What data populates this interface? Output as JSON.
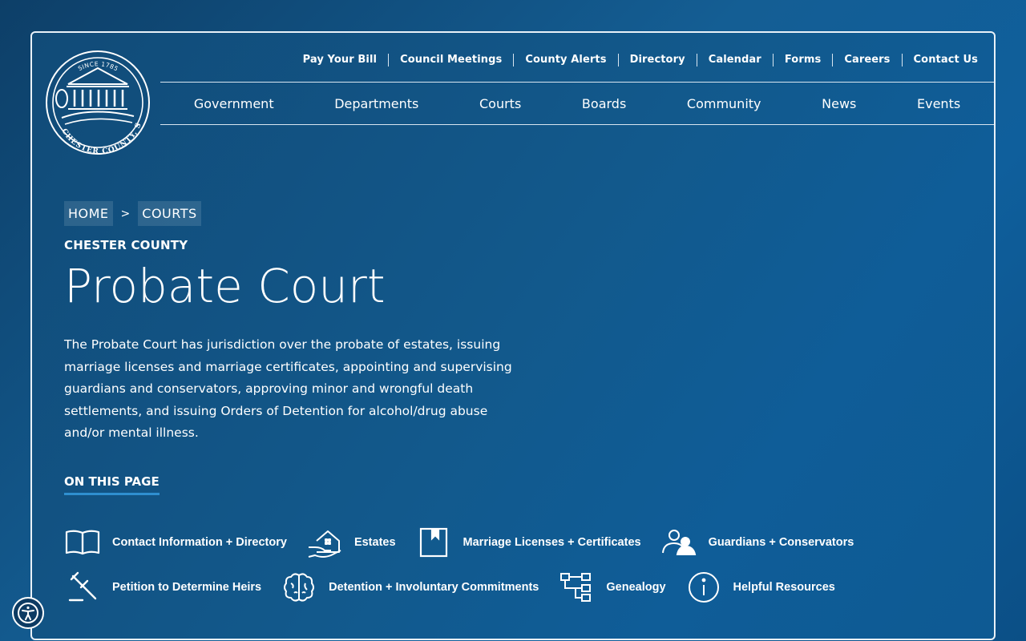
{
  "logo": {
    "top_text": "SINCE 1785",
    "bottom_text": "CHESTER COUNTY, SC"
  },
  "utility_nav": [
    "Pay Your Bill",
    "Council Meetings",
    "County Alerts",
    "Directory",
    "Calendar",
    "Forms",
    "Careers",
    "Contact Us"
  ],
  "main_nav": [
    "Government",
    "Departments",
    "Courts",
    "Boards",
    "Community",
    "News",
    "Events"
  ],
  "breadcrumb": {
    "home": "HOME",
    "separator": ">",
    "current": "COURTS"
  },
  "eyebrow": "CHESTER COUNTY",
  "title": "Probate Court",
  "intro": "The Probate Court has jurisdiction over the probate of estates, issuing marriage licenses and marriage certificates, appointing and supervising guardians and conservators, approving minor and wrongful death settlements, and issuing Orders of Detention for alcohol/drug abuse and/or mental illness.",
  "on_this_page": "ON THIS PAGE",
  "page_links": [
    {
      "label": "Contact Information + Directory",
      "icon": "book-icon"
    },
    {
      "label": "Estates",
      "icon": "house-in-hand-icon"
    },
    {
      "label": "Marriage Licenses + Certificates",
      "icon": "bookmark-icon"
    },
    {
      "label": "Guardians + Conservators",
      "icon": "people-icon"
    },
    {
      "label": "Petition to Determine Heirs",
      "icon": "gavel-icon"
    },
    {
      "label": "Detention + Involuntary Commitments",
      "icon": "brain-icon"
    },
    {
      "label": "Genealogy",
      "icon": "family-tree-icon"
    },
    {
      "label": "Helpful Resources",
      "icon": "info-icon"
    }
  ],
  "colors": {
    "background": "#124f80",
    "accent_underline": "#2f8fd0",
    "text": "#ffffff"
  }
}
